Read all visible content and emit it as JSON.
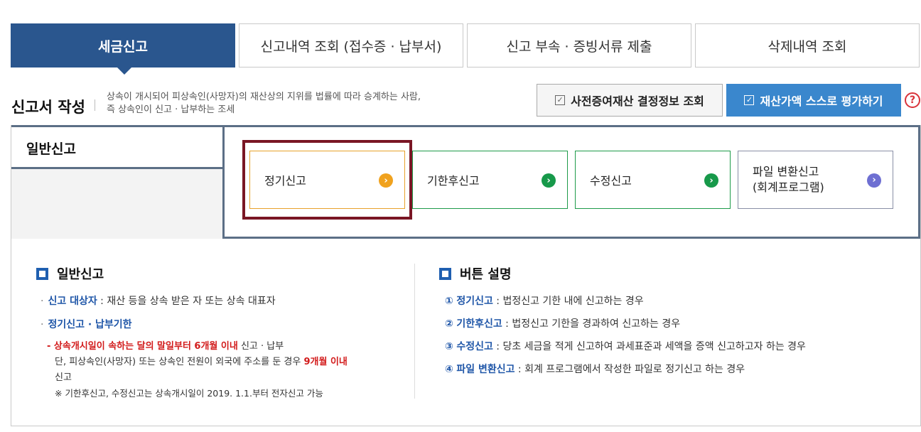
{
  "tabs": [
    {
      "label": "세금신고",
      "active": true
    },
    {
      "label": "신고내역 조회 (접수증 · 납부서)"
    },
    {
      "label": "신고 부속 · 증빙서류 제출"
    },
    {
      "label": "삭제내역 조회"
    }
  ],
  "form": {
    "title": "신고서 작성",
    "desc_line1": "상속이 개시되어 피상속인(사망자)의 재산상의 지위를 법률에 따라 승계하는 사람,",
    "desc_line2": "즉 상속인이 신고 · 납부하는 조세"
  },
  "actions": {
    "lookup_label": "사전증여재산 결정정보 조회",
    "evaluate_label": "재산가액 스스로 평가하기",
    "help_label": "?"
  },
  "general": {
    "group_label": "일반신고",
    "cards": [
      {
        "label": "정기신고",
        "arrow": "›",
        "color": "#f0a21e"
      },
      {
        "label": "기한후신고",
        "arrow": "›",
        "color": "#17994a"
      },
      {
        "label": "수정신고",
        "arrow": "›",
        "color": "#17994a"
      },
      {
        "label_line1": "파일 변환신고",
        "label_line2": "(회계프로그램)",
        "arrow": "›",
        "color": "#6e6fd2"
      }
    ]
  },
  "info_left": {
    "title": "일반신고",
    "target_label": "신고 대상자",
    "target_text": " : 재산 등을 상속 받은 자 또는 상속 대표자",
    "deadline_label": "정기신고 · 납부기한",
    "deadline_red": "상속개시일이 속하는 달의 말일부터 6개월 이내",
    "deadline_tail": " 신고 · 납부",
    "note_prefix": "단, 피상속인(사망자) 또는 상속인 전원이 외국에 주소를 둔 경우 ",
    "note_red": "9개월 이내",
    "note_tail": "신고",
    "footnote": "※ 기한후신고, 수정신고는 상속개시일이 2019. 1.1.부터 전자신고 가능"
  },
  "info_right": {
    "title": "버튼 설명",
    "items": [
      {
        "num": "①",
        "name": "정기신고",
        "text": " : 법정신고 기한 내에 신고하는 경우"
      },
      {
        "num": "②",
        "name": "기한후신고",
        "text": " : 법정신고 기한을 경과하여 신고하는 경우"
      },
      {
        "num": "③",
        "name": "수정신고",
        "text": " : 당초 세금을 적게 신고하여 과세표준과 세액을 증액 신고하고자 하는 경우"
      },
      {
        "num": "④",
        "name": "파일 변환신고",
        "text": " : 회계 프로그램에서 작성한 파일로 정기신고 하는 경우"
      }
    ]
  }
}
